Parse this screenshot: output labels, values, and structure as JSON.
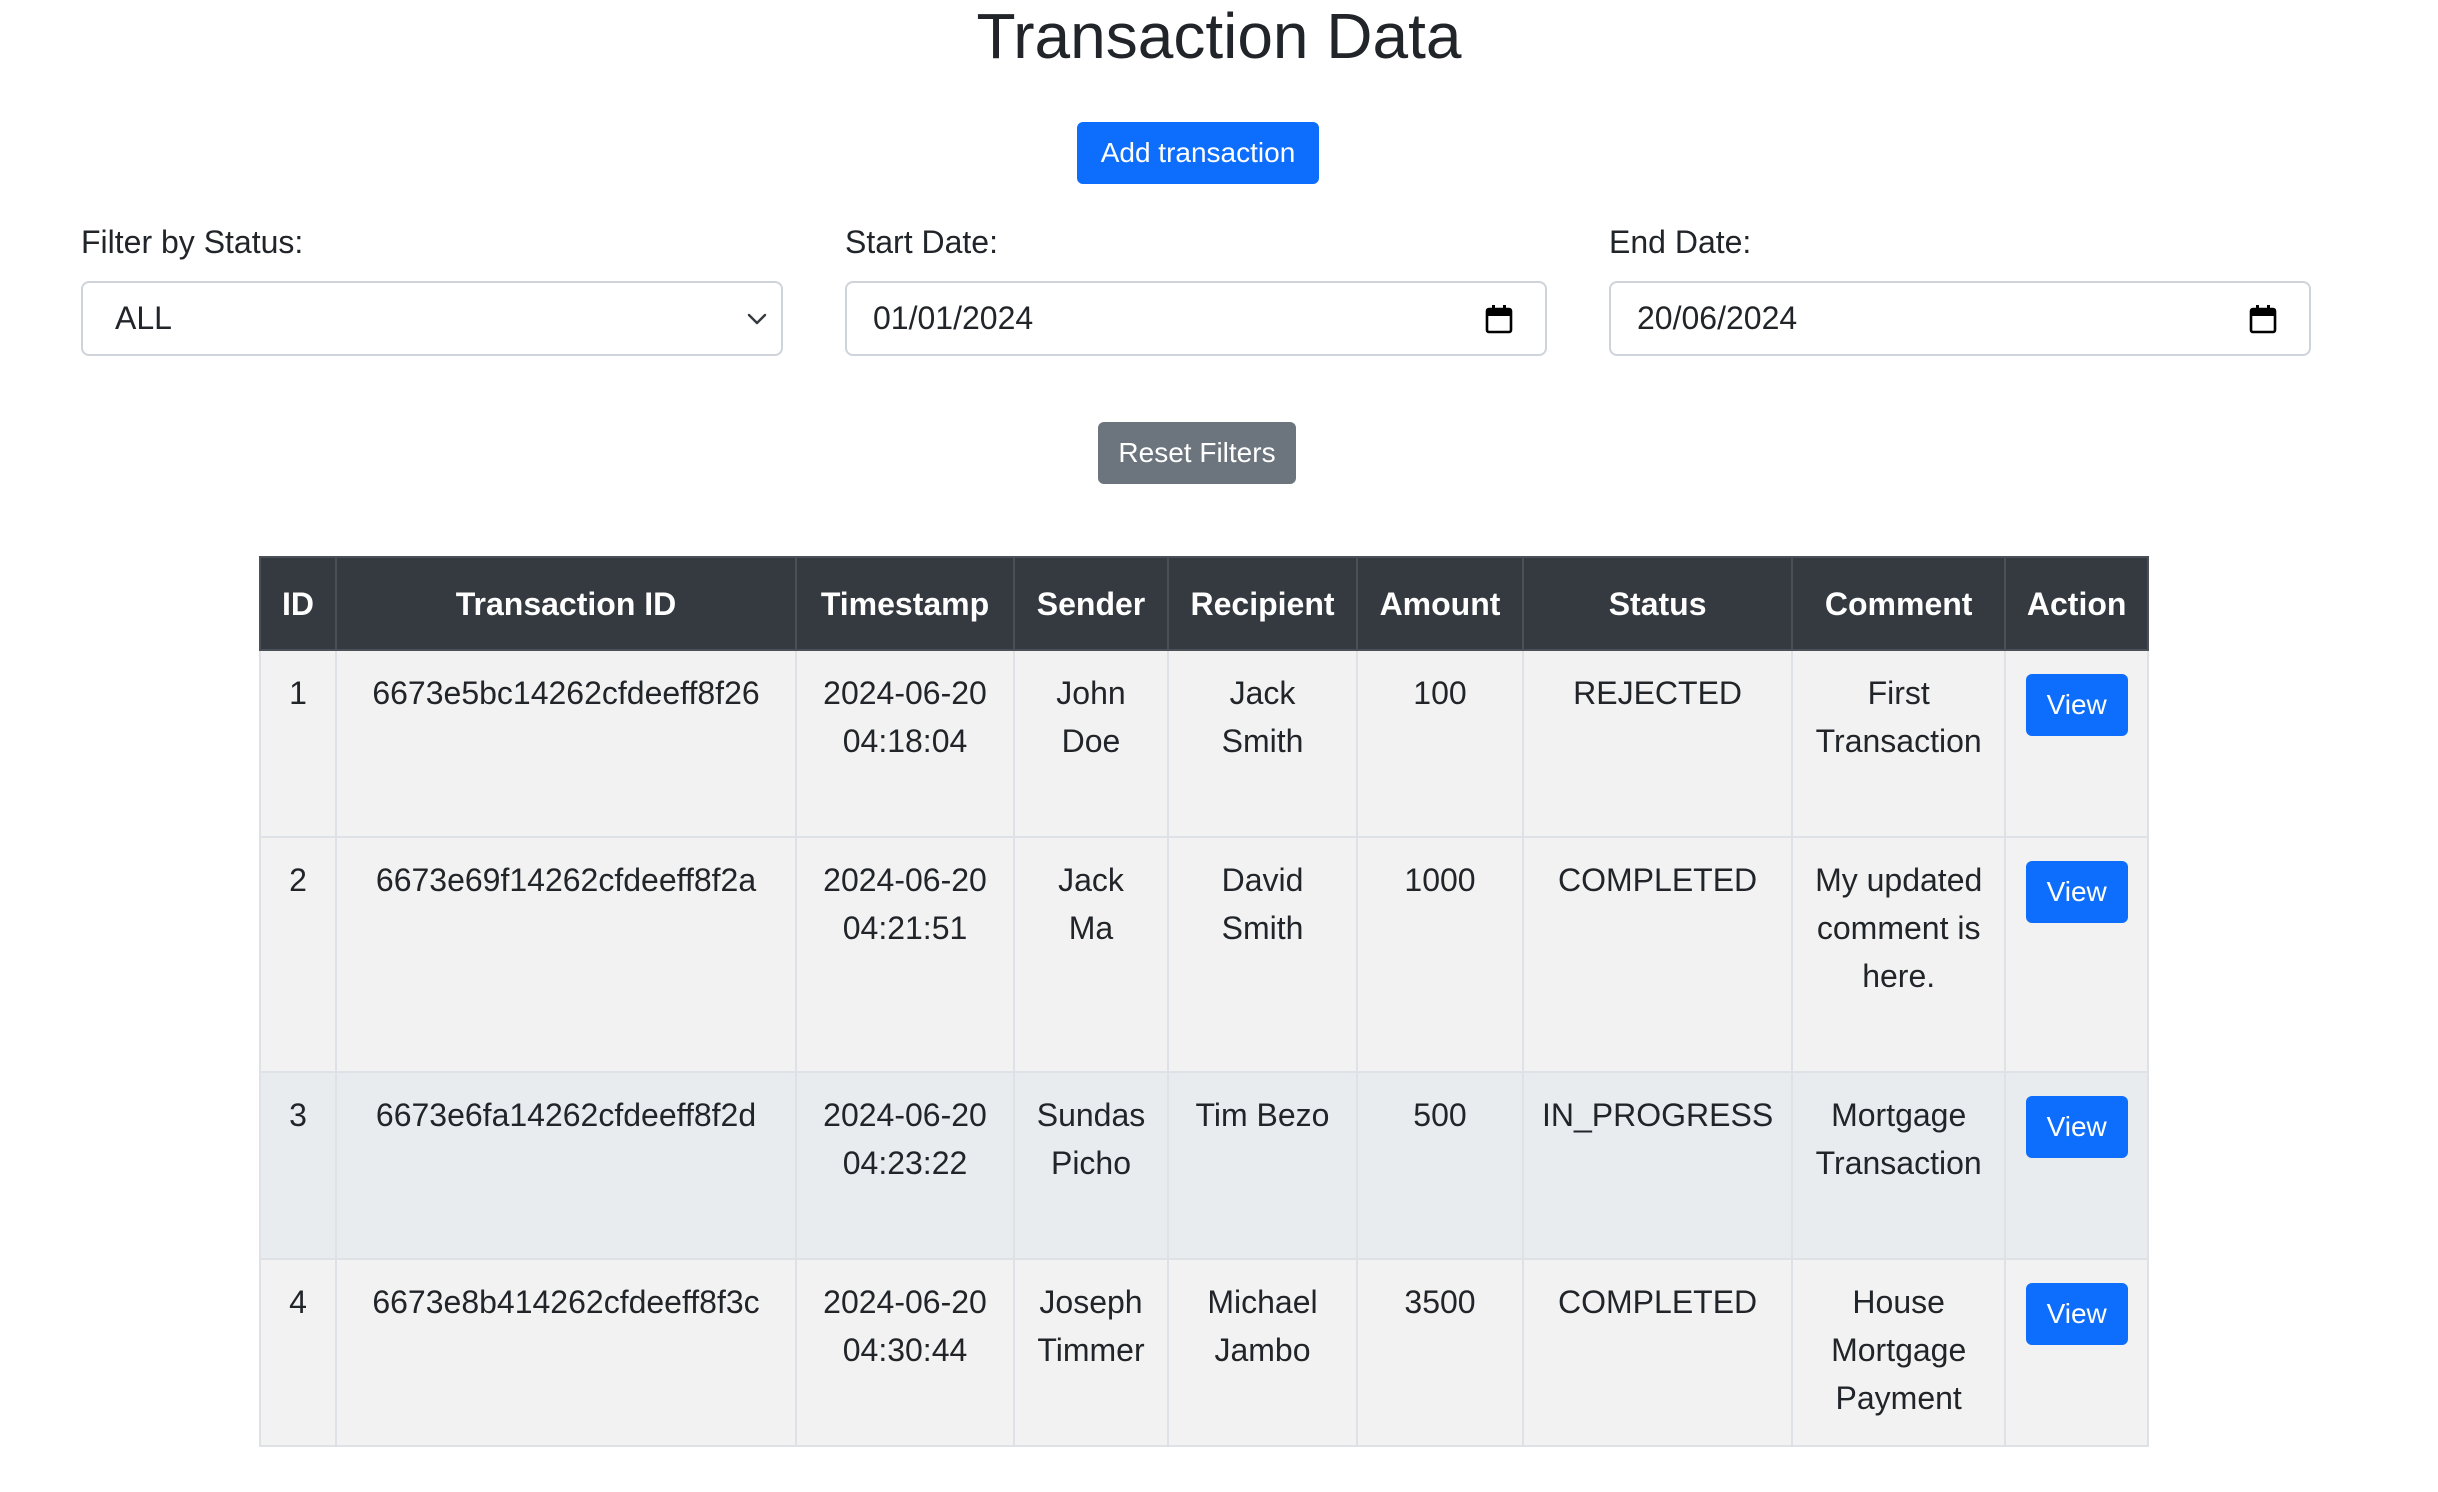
{
  "page": {
    "title": "Transaction Data",
    "add_button_label": "Add transaction",
    "reset_button_label": "Reset Filters"
  },
  "filters": {
    "status": {
      "label": "Filter by Status:",
      "value": "ALL"
    },
    "start_date": {
      "label": "Start Date:",
      "value": "01/01/2024"
    },
    "end_date": {
      "label": "End Date:",
      "value": "20/06/2024"
    }
  },
  "table": {
    "headers": [
      "ID",
      "Transaction ID",
      "Timestamp",
      "Sender",
      "Recipient",
      "Amount",
      "Status",
      "Comment",
      "Action"
    ],
    "rows": [
      {
        "id": "1",
        "transaction_id": "6673e5bc14262cfdeeff8f26",
        "timestamp": "2024-06-20 04:18:04",
        "sender": "John Doe",
        "recipient": "Jack Smith",
        "amount": "100",
        "status": "REJECTED",
        "comment": "First Transaction",
        "action": "View"
      },
      {
        "id": "2",
        "transaction_id": "6673e69f14262cfdeeff8f2a",
        "timestamp": "2024-06-20 04:21:51",
        "sender": "Jack Ma",
        "recipient": "David Smith",
        "amount": "1000",
        "status": "COMPLETED",
        "comment": "My updated comment is here.",
        "action": "View"
      },
      {
        "id": "3",
        "transaction_id": "6673e6fa14262cfdeeff8f2d",
        "timestamp": "2024-06-20 04:23:22",
        "sender": "Sundas Picho",
        "recipient": "Tim Bezo",
        "amount": "500",
        "status": "IN_PROGRESS",
        "comment": "Mortgage Transaction",
        "action": "View"
      },
      {
        "id": "4",
        "transaction_id": "6673e8b414262cfdeeff8f3c",
        "timestamp": "2024-06-20 04:30:44",
        "sender": "Joseph Timmer",
        "recipient": "Michael Jambo",
        "amount": "3500",
        "status": "COMPLETED",
        "comment": "House Mortgage Payment",
        "action": "View"
      }
    ]
  },
  "colors": {
    "primary": "#0d6efd",
    "secondary": "#6c757d",
    "table_header": "#343a40",
    "row_striped": "#f2f2f2",
    "row_hover": "#e9ecef"
  },
  "icons": {
    "status_dropdown": "chevron-down-icon",
    "date_picker": "calendar-icon"
  }
}
